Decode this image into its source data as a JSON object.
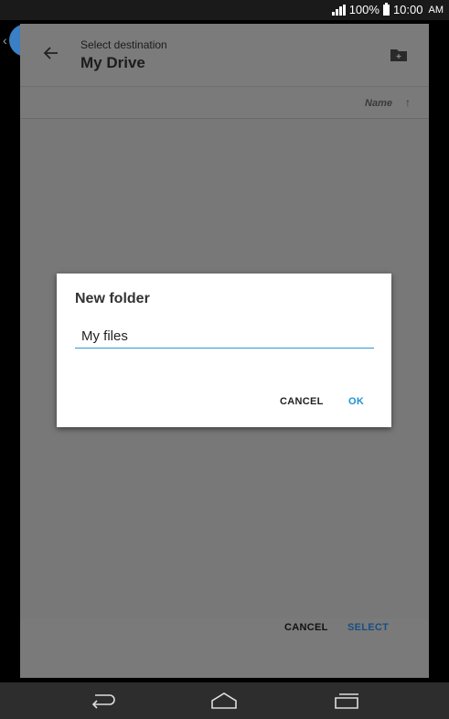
{
  "status_bar": {
    "battery": "100%",
    "time": "10:00",
    "ampm": "AM"
  },
  "header": {
    "subtitle": "Select destination",
    "title": "My Drive"
  },
  "sort": {
    "label": "Name",
    "arrow": "↑"
  },
  "dialog": {
    "title": "New folder",
    "input_value": "My files",
    "cancel_label": "CANCEL",
    "ok_label": "OK"
  },
  "footer": {
    "cancel_label": "CANCEL",
    "select_label": "SELECT"
  },
  "icons": [
    "back-arrow-icon",
    "new-folder-icon",
    "signal-icon",
    "battery-icon",
    "nav-back-icon",
    "nav-home-icon",
    "nav-recents-icon"
  ],
  "colors": {
    "accent": "#1e90d6",
    "select": "#1a4e80",
    "scrim": "#787878"
  }
}
